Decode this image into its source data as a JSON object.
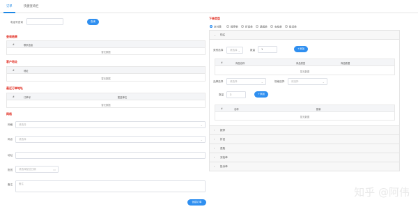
{
  "tabs": [
    {
      "label": "订单"
    },
    {
      "label": "快捷查询栏"
    }
  ],
  "left": {
    "phone_label": "电话号查询",
    "phone_placeholder": "",
    "search_btn": "查询",
    "sections": {
      "query_result": "查询结果",
      "customer_address": "客户地址",
      "recent_orders": "最近订单地址",
      "network": "网格"
    },
    "table1": {
      "cols": [
        "#",
        "联系信息"
      ],
      "empty": "暂无数据"
    },
    "table2": {
      "cols": [
        "#",
        "地址"
      ],
      "empty": "暂无数据"
    },
    "table3": {
      "cols": [
        "#",
        "订单号",
        "配送单位"
      ],
      "empty": "暂无数据"
    },
    "form": {
      "field1_label": "网格",
      "field1_placeholder": "请选择",
      "field2_label": "网点",
      "field2_placeholder": "请选择",
      "field3_label": "地址",
      "field3_placeholder": "",
      "field4_label": "配送",
      "field4_placeholder": "请选择配送日期",
      "remark_label": "备注",
      "remark_placeholder": "备注",
      "create_btn": "创建订单"
    }
  },
  "right": {
    "order_type_label": "下单类型",
    "order_types": [
      "全付费",
      "报停单",
      "折旧单",
      "退瓶单",
      "安检单",
      "投诉单"
    ],
    "panel_open_title": "购买",
    "cat_label": "类别选择",
    "cat_placeholder": "请选择",
    "qty_label": "数量",
    "qty_value": "1",
    "add_btn": "+添加",
    "goods_table": {
      "cols": [
        "#",
        "商品名称",
        "商品类型",
        "商品数据"
      ],
      "empty": "暂无数据"
    },
    "sel1_label": "品牌选择",
    "sel1_placeholder": "请选择",
    "sel2_label": "规格选择",
    "sel2_placeholder": "请选择",
    "qty2_label": "数量",
    "qty2_value": "1",
    "add_btn2": "+添加",
    "bottle_table": {
      "cols": [
        "#",
        "名称",
        "数量"
      ],
      "empty": "暂无数据"
    },
    "collapsed": [
      "报停",
      "折旧",
      "退瓶",
      "安检单",
      "投诉单"
    ]
  },
  "watermark": "知乎 @阿伟",
  "colors": {
    "primary": "#2f8ff0",
    "section_title": "#e0271b",
    "tab_active": "#1e88e5"
  }
}
